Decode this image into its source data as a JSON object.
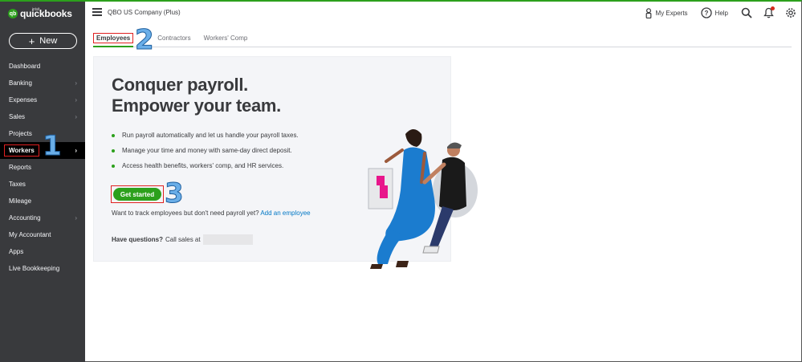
{
  "brand": {
    "logo_text": "quickbooks",
    "logo_super": "intuit",
    "logo_mark": "qb"
  },
  "sidebar": {
    "new_label": "New",
    "items": [
      {
        "label": "Dashboard",
        "chevron": false
      },
      {
        "label": "Banking",
        "chevron": true
      },
      {
        "label": "Expenses",
        "chevron": true
      },
      {
        "label": "Sales",
        "chevron": true
      },
      {
        "label": "Projects",
        "chevron": false
      },
      {
        "label": "Workers",
        "chevron": true,
        "active": true
      },
      {
        "label": "Reports",
        "chevron": false
      },
      {
        "label": "Taxes",
        "chevron": false
      },
      {
        "label": "Mileage",
        "chevron": false
      },
      {
        "label": "Accounting",
        "chevron": true
      },
      {
        "label": "My Accountant",
        "chevron": false
      },
      {
        "label": "Apps",
        "chevron": false
      },
      {
        "label": "Live Bookkeeping",
        "chevron": false
      }
    ]
  },
  "header": {
    "company": "QBO US Company (Plus)",
    "my_experts": "My Experts",
    "help": "Help"
  },
  "tabs": [
    {
      "label": "Employees",
      "active": true
    },
    {
      "label": "Contractors",
      "active": false
    },
    {
      "label": "Workers' Comp",
      "active": false
    }
  ],
  "main": {
    "headline_1": "Conquer payroll.",
    "headline_2": "Empower your team.",
    "bullets": [
      "Run payroll automatically and let us handle your payroll taxes.",
      "Manage your time and money with same-day direct deposit.",
      "Access health benefits, workers' comp, and HR services."
    ],
    "cta_label": "Get started",
    "track_text": "Want to track employees but don't need payroll yet?",
    "track_link": "Add an employee",
    "questions_bold": "Have questions?",
    "questions_text": "Call sales at"
  },
  "annotations": {
    "step1": "1",
    "step2": "2",
    "step3": "3"
  },
  "colors": {
    "accent": "#2ca01c",
    "sidebar_bg": "#393a3d",
    "link": "#0077c5",
    "highlight_box": "#e02020"
  },
  "icons": [
    "hamburger-icon",
    "my-experts-icon",
    "help-icon",
    "search-icon",
    "bell-icon",
    "gear-icon",
    "chevron-right-icon"
  ]
}
